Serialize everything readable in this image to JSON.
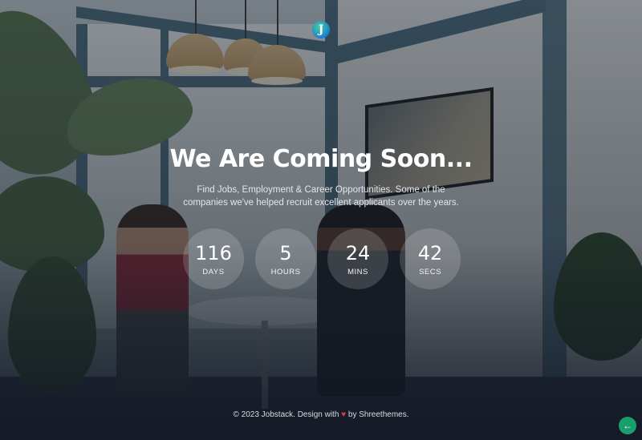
{
  "brand": {
    "logo_letter": "J"
  },
  "hero": {
    "title": "We Are Coming Soon...",
    "subtitle": "Find Jobs, Employment & Career Opportunities. Some of the companies we've helped recruit excellent applicants over the years."
  },
  "countdown": [
    {
      "value": "116",
      "label": "DAYS"
    },
    {
      "value": "5",
      "label": "HOURS"
    },
    {
      "value": "24",
      "label": "MINS"
    },
    {
      "value": "42",
      "label": "SECS"
    }
  ],
  "footer": {
    "prefix": "© 2023 Jobstack. Design with",
    "heart_icon": "♥",
    "suffix": "by Shreethemes."
  },
  "back_to_top": {
    "icon": "←",
    "icon_name": "arrow-left-icon"
  },
  "colors": {
    "accent": "#1a9f6c",
    "heart": "#e03b4b"
  }
}
